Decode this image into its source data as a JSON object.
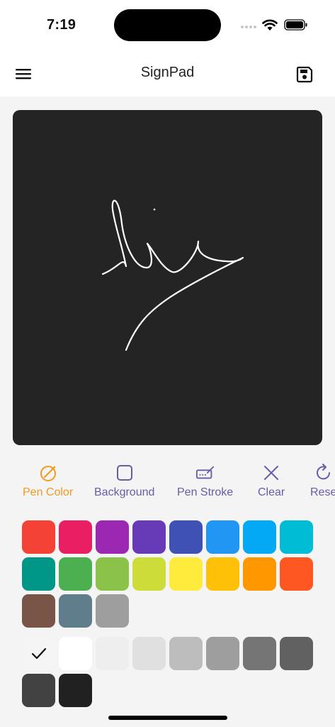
{
  "status": {
    "time": "7:19"
  },
  "app": {
    "title": "SignPad"
  },
  "icons": {
    "menu": "menu-icon",
    "save": "save-icon",
    "wifi": "wifi-icon",
    "battery": "battery-icon"
  },
  "toolbar": {
    "active": "Pen Color",
    "active_color": "#f29a1e",
    "inactive_color": "#6b5aa8",
    "items": [
      {
        "label": "Pen Color",
        "icon": "pen-color-icon"
      },
      {
        "label": "Background",
        "icon": "square-icon"
      },
      {
        "label": "Pen Stroke",
        "icon": "pen-stroke-icon"
      },
      {
        "label": "Clear",
        "icon": "close-icon"
      },
      {
        "label": "Reset",
        "icon": "reset-icon"
      }
    ]
  },
  "canvas": {
    "background": "#242424",
    "stroke_color": "#ffffff"
  },
  "palette": {
    "selected": "#f5f5f5",
    "rows": [
      [
        "#f44336",
        "#e91e63",
        "#9c27b0",
        "#673ab7",
        "#3f51b5",
        "#2196f3",
        "#03a9f4",
        "#00bcd4"
      ],
      [
        "#009688",
        "#4caf50",
        "#8bc34a",
        "#cddc39",
        "#ffeb3b",
        "#ffc107",
        "#ff9800",
        "#ff5722"
      ],
      [
        "#795548",
        "#607d8b",
        "#9e9e9e"
      ],
      [
        "#f5f5f5",
        "#ffffff",
        "#eeeeee",
        "#e0e0e0",
        "#bdbdbd",
        "#9e9e9e",
        "#757575",
        "#616161"
      ],
      [
        "#424242",
        "#212121"
      ]
    ]
  }
}
